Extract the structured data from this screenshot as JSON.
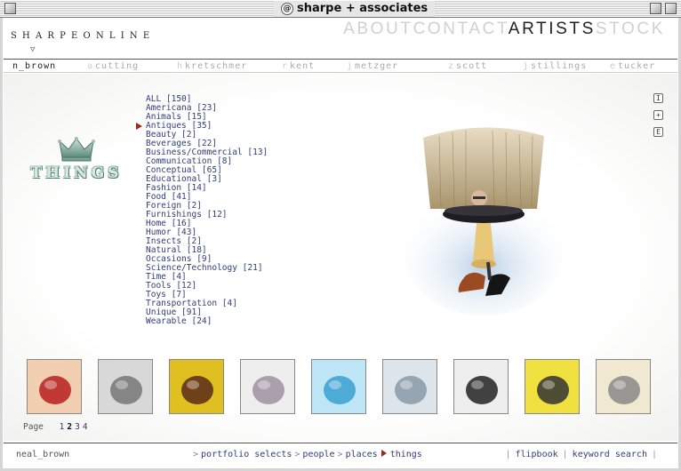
{
  "window": {
    "title": "sharpe + associates"
  },
  "header": {
    "logo": "SHARPEONLINE",
    "nav": [
      {
        "label": "ABOUT",
        "active": false
      },
      {
        "label": "CONTACT",
        "active": false
      },
      {
        "label": "ARTISTS",
        "active": true
      },
      {
        "label": "STOCK",
        "active": false
      }
    ]
  },
  "artists": [
    {
      "prefix": "",
      "label": "n_brown",
      "active": true
    },
    {
      "prefix": "a",
      "label": "cutting",
      "active": false
    },
    {
      "prefix": "h",
      "label": "kretschmer",
      "active": false
    },
    {
      "prefix": "r",
      "label": "kent",
      "active": false
    },
    {
      "prefix": "j",
      "label": "metzger",
      "active": false
    },
    {
      "prefix": "z",
      "label": "scott",
      "active": false
    },
    {
      "prefix": "j",
      "label": "stillings",
      "active": false
    },
    {
      "prefix": "e",
      "label": "tucker",
      "active": false
    }
  ],
  "section": {
    "logo_text": "THINGS"
  },
  "categories": [
    {
      "label": "ALL [150]",
      "active": false
    },
    {
      "label": "Americana [23]",
      "active": false
    },
    {
      "label": "Animals [15]",
      "active": false
    },
    {
      "label": "Antiques [35]",
      "active": true
    },
    {
      "label": "Beauty [2]",
      "active": false
    },
    {
      "label": "Beverages [22]",
      "active": false
    },
    {
      "label": "Business/Commercial [13]",
      "active": false
    },
    {
      "label": "Communication [8]",
      "active": false
    },
    {
      "label": "Conceptual [65]",
      "active": false
    },
    {
      "label": "Educational [3]",
      "active": false
    },
    {
      "label": "Fashion [14]",
      "active": false
    },
    {
      "label": "Food [41]",
      "active": false
    },
    {
      "label": "Foreign [2]",
      "active": false
    },
    {
      "label": "Furnishings [12]",
      "active": false
    },
    {
      "label": "Home [16]",
      "active": false
    },
    {
      "label": "Humor [43]",
      "active": false
    },
    {
      "label": "Insects [2]",
      "active": false
    },
    {
      "label": "Natural [18]",
      "active": false
    },
    {
      "label": "Occasions [9]",
      "active": false
    },
    {
      "label": "Science/Technology [21]",
      "active": false
    },
    {
      "label": "Time [4]",
      "active": false
    },
    {
      "label": "Tools [12]",
      "active": false
    },
    {
      "label": "Toys [7]",
      "active": false
    },
    {
      "label": "Transportation [4]",
      "active": false
    },
    {
      "label": "Unique [91]",
      "active": false
    },
    {
      "label": "Wearable [24]",
      "active": false
    }
  ],
  "side_icons": [
    {
      "name": "info-icon",
      "glyph": "I"
    },
    {
      "name": "add-icon",
      "glyph": "+"
    },
    {
      "name": "email-icon",
      "glyph": "E"
    }
  ],
  "thumbnails": [
    {
      "name": "woman-red-hat",
      "colors": [
        "#b81e1e",
        "#f2cfb0"
      ]
    },
    {
      "name": "chain-lock",
      "colors": [
        "#777",
        "#d8d8d8"
      ]
    },
    {
      "name": "wooden-chair",
      "colors": [
        "#5a2a1a",
        "#e0c020"
      ]
    },
    {
      "name": "eyeglasses",
      "colors": [
        "#a090a0",
        "#eee"
      ]
    },
    {
      "name": "blue-clock",
      "colors": [
        "#3aa0d0",
        "#bfe6f6"
      ]
    },
    {
      "name": "glass-ship",
      "colors": [
        "#8a9aa8",
        "#dde4ea"
      ]
    },
    {
      "name": "stool-legs",
      "colors": [
        "#222",
        "#eee"
      ]
    },
    {
      "name": "hat-top-view",
      "colors": [
        "#333",
        "#f0e040"
      ]
    },
    {
      "name": "coffee-pot",
      "colors": [
        "#888",
        "#f0e8d0"
      ]
    }
  ],
  "pager": {
    "label": "Page",
    "pages": [
      "1",
      "2",
      "3",
      "4"
    ],
    "current": "2"
  },
  "footer": {
    "username": "neal_brown",
    "breadcrumbs": [
      {
        "label": "portfolio selects",
        "active": false
      },
      {
        "label": "people",
        "active": false
      },
      {
        "label": "places",
        "active": false
      },
      {
        "label": "things",
        "active": true
      }
    ],
    "links": [
      "flipbook",
      "keyword search"
    ]
  },
  "colors": {
    "link": "#2d3e7a",
    "accent": "#9b2a1b",
    "inactive_nav": "#d0d0d0"
  }
}
